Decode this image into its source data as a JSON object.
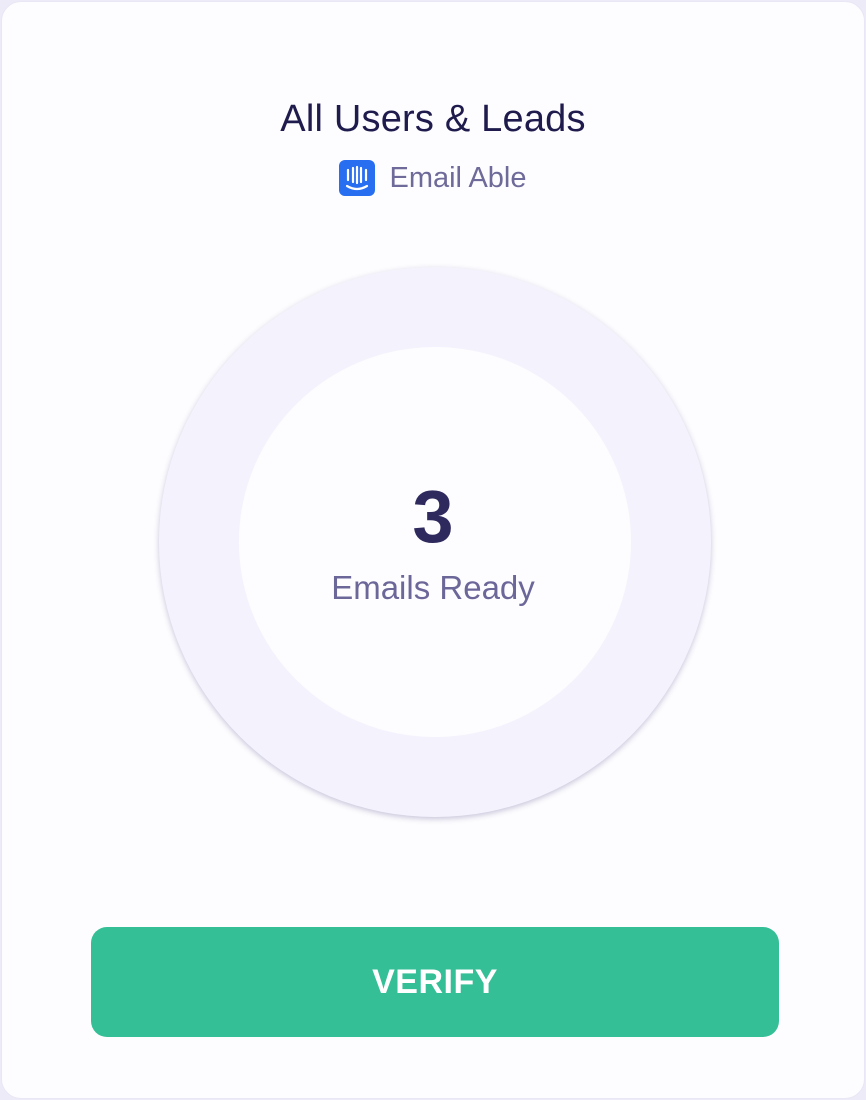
{
  "card": {
    "title": "All Users & Leads",
    "source": {
      "icon": "intercom-logo-icon",
      "label": "Email Able",
      "icon_color": "#286EF1"
    }
  },
  "summary": {
    "count": "3",
    "label": "Emails Ready"
  },
  "actions": {
    "verify_label": "VERIFY",
    "verify_color": "#35BF97"
  }
}
